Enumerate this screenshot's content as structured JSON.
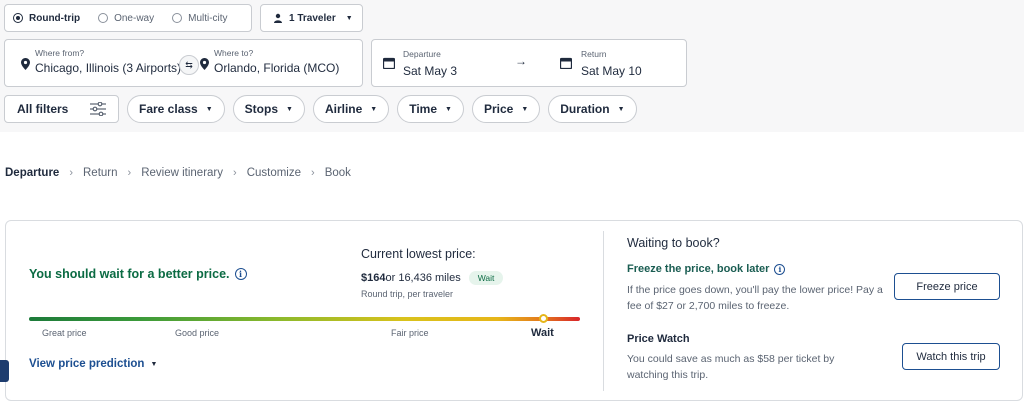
{
  "search": {
    "trip_types": [
      {
        "label": "Round-trip",
        "selected": true
      },
      {
        "label": "One-way",
        "selected": false
      },
      {
        "label": "Multi-city",
        "selected": false
      }
    ],
    "travelers_label": "1 Traveler",
    "from_label": "Where from?",
    "from_value": "Chicago, Illinois (3 Airports)",
    "to_label": "Where to?",
    "to_value": "Orlando, Florida (MCO)",
    "departure_label": "Departure",
    "departure_value": "Sat May 3",
    "return_label": "Return",
    "return_value": "Sat May 10"
  },
  "filters": {
    "all_filters_label": "All filters",
    "chips": [
      "Fare class",
      "Stops",
      "Airline",
      "Time",
      "Price",
      "Duration"
    ]
  },
  "breadcrumb": {
    "steps": [
      "Departure",
      "Return",
      "Review itinerary",
      "Customize",
      "Book"
    ]
  },
  "price_advice": {
    "message": "You should wait for a better price.",
    "current_lowest_label": "Current lowest price:",
    "price": "$164",
    "price_suffix": " or 16,436 miles",
    "badge": "Wait",
    "note": "Round trip, per traveler",
    "scale_labels": {
      "great": "Great price",
      "good": "Good price",
      "fair": "Fair price",
      "wait": "Wait"
    },
    "prediction_link": "View price prediction"
  },
  "booking_options": {
    "title": "Waiting to book?",
    "freeze_title": "Freeze the price, book later",
    "freeze_desc": "If the price goes down, you'll pay the lower price! Pay a fee of $27 or 2,700 miles to freeze.",
    "freeze_button": "Freeze price",
    "watch_title": "Price Watch",
    "watch_desc": "You could save as much as $58 per ticket by watching this trip.",
    "watch_button": "Watch this trip"
  },
  "colors": {
    "primary_text": "#1f2a3d",
    "accent_blue": "#1d4f91",
    "wait_green": "#0b6b43",
    "freeze_teal": "#1a5d52"
  }
}
